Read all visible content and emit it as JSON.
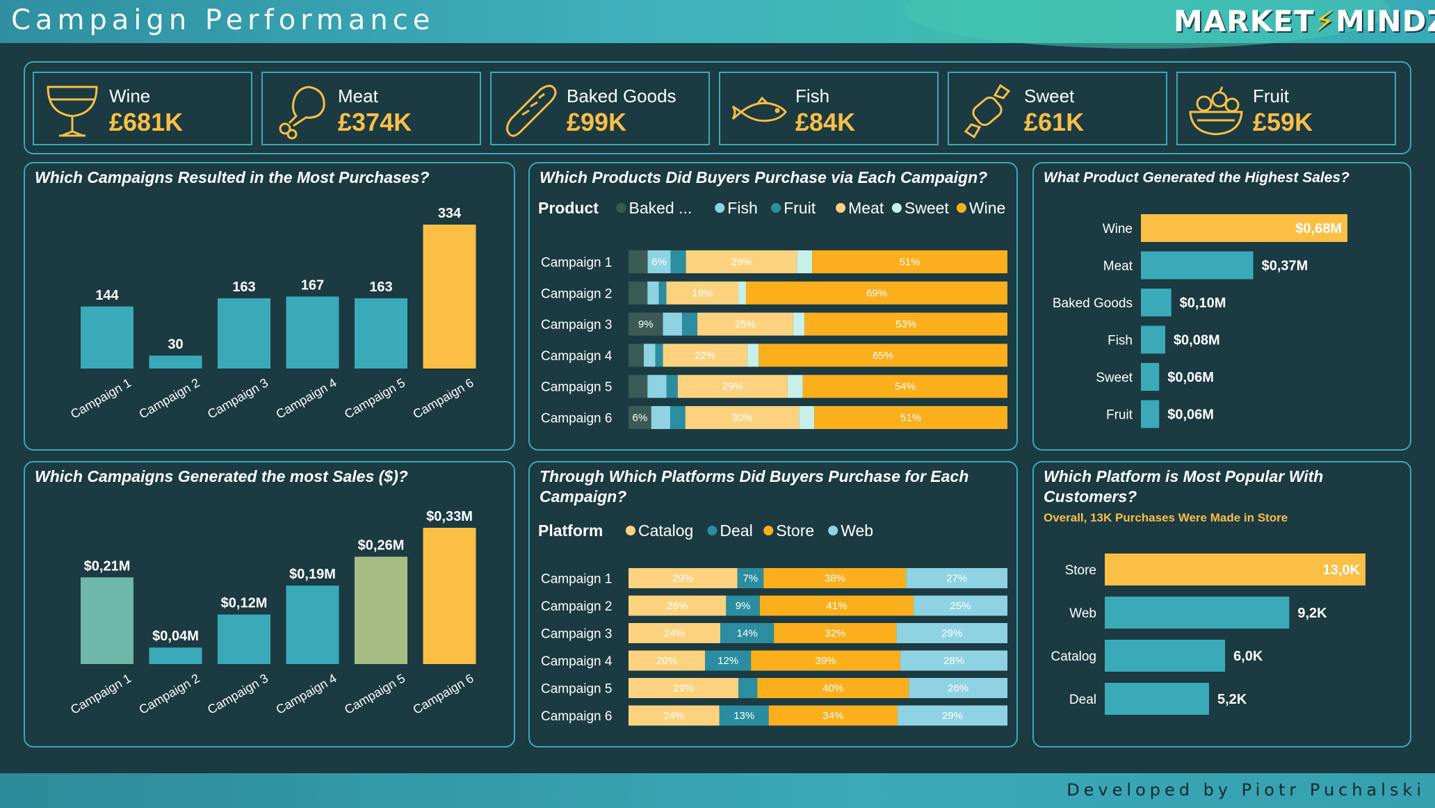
{
  "header": {
    "title": "Campaign Performance",
    "logo_left": "MARKET",
    "logo_right": "MINDZ"
  },
  "footer": {
    "credit": "Developed by Piotr Puchalski"
  },
  "colors": {
    "teal": "#3aaab8",
    "gold": "#fbbf45",
    "orange": "#fbaf1c",
    "light_gold": "#fcd27f",
    "bg": "#1b3a42",
    "dark_gray": "#3b5a55",
    "light_blue": "#8fd3e3",
    "mid_teal": "#2b8d9f",
    "mint": "#c7f0e9",
    "sage": "#6fb7a8",
    "olive": "#a8bd84"
  },
  "kpis": [
    {
      "label": "Wine",
      "value": "£681K",
      "icon": "wine-glass-icon"
    },
    {
      "label": "Meat",
      "value": "£374K",
      "icon": "drumstick-icon"
    },
    {
      "label": "Baked Goods",
      "value": "£99K",
      "icon": "baguette-icon"
    },
    {
      "label": "Fish",
      "value": "£84K",
      "icon": "fish-icon"
    },
    {
      "label": "Sweet",
      "value": "£61K",
      "icon": "candy-icon"
    },
    {
      "label": "Fruit",
      "value": "£59K",
      "icon": "fruit-bowl-icon"
    }
  ],
  "panels": {
    "purchases": {
      "title": "Which Campaigns Resulted in the Most Purchases?"
    },
    "products": {
      "title": "Which Products Did Buyers Purchase via Each Campaign?",
      "legend_title": "Product"
    },
    "top_product": {
      "title": "What Product Generated the Highest Sales?"
    },
    "sales": {
      "title": "Which Campaigns Generated the most Sales ($)?"
    },
    "platforms": {
      "title_line1": "Through Which Platforms Did Buyers Purchase for Each",
      "title_line2": "Campaign?",
      "legend_title": "Platform"
    },
    "popular_platform": {
      "title_line1": "Which Platform is Most Popular With",
      "title_line2": "Customers?",
      "subtitle": "Overall, 13K Purchases Were Made in Store"
    }
  },
  "chart_data": [
    {
      "id": "purchases",
      "type": "bar",
      "categories": [
        "Campaign 1",
        "Campaign 2",
        "Campaign 3",
        "Campaign 4",
        "Campaign 5",
        "Campaign 6"
      ],
      "values": [
        144,
        30,
        163,
        167,
        163,
        334
      ],
      "labels": [
        "144",
        "30",
        "163",
        "167",
        "163",
        "334"
      ],
      "colors": [
        "#3aaab8",
        "#3aaab8",
        "#3aaab8",
        "#3aaab8",
        "#3aaab8",
        "#fbbf45"
      ],
      "ylim": [
        0,
        334
      ]
    },
    {
      "id": "products",
      "type": "bar",
      "stacked": true,
      "orientation": "horizontal",
      "categories": [
        "Campaign 1",
        "Campaign 2",
        "Campaign 3",
        "Campaign 4",
        "Campaign 5",
        "Campaign 6"
      ],
      "series": [
        {
          "name": "Baked ...",
          "color": "#3b5a55",
          "values": [
            5,
            5,
            9,
            4,
            5,
            6
          ],
          "labels": [
            "",
            "",
            "9%",
            "",
            "",
            "6%"
          ]
        },
        {
          "name": "Fish",
          "color": "#8fd3e3",
          "values": [
            6,
            3,
            5,
            3,
            5,
            5
          ],
          "labels": [
            "6%",
            "",
            "",
            "",
            "",
            ""
          ]
        },
        {
          "name": "Fruit",
          "color": "#2b8d9f",
          "values": [
            4,
            2,
            4,
            2,
            3,
            4
          ],
          "labels": [
            "",
            "",
            "",
            "",
            "",
            ""
          ]
        },
        {
          "name": "Meat",
          "color": "#fcd27f",
          "values": [
            29,
            19,
            25,
            22,
            29,
            30
          ],
          "labels": [
            "29%",
            "19%",
            "25%",
            "22%",
            "29%",
            "30%"
          ]
        },
        {
          "name": "Sweet",
          "color": "#c7f0e9",
          "values": [
            4,
            2,
            3,
            3,
            4,
            4
          ],
          "labels": [
            "",
            "",
            "",
            "",
            "",
            ""
          ]
        },
        {
          "name": "Wine",
          "color": "#fbaf1c",
          "values": [
            51,
            69,
            53,
            65,
            54,
            51
          ],
          "labels": [
            "51%",
            "69%",
            "53%",
            "65%",
            "54%",
            "51%"
          ]
        }
      ],
      "xlim": [
        0,
        100
      ]
    },
    {
      "id": "top_product",
      "type": "bar",
      "orientation": "horizontal",
      "categories": [
        "Wine",
        "Meat",
        "Baked Goods",
        "Fish",
        "Sweet",
        "Fruit"
      ],
      "values": [
        0.68,
        0.37,
        0.1,
        0.08,
        0.06,
        0.06
      ],
      "labels": [
        "$0,68M",
        "$0,37M",
        "$0,10M",
        "$0,08M",
        "$0,06M",
        "$0,06M"
      ],
      "colors": [
        "#fbbf45",
        "#3aaab8",
        "#3aaab8",
        "#3aaab8",
        "#3aaab8",
        "#3aaab8"
      ]
    },
    {
      "id": "sales",
      "type": "bar",
      "categories": [
        "Campaign 1",
        "Campaign 2",
        "Campaign 3",
        "Campaign 4",
        "Campaign 5",
        "Campaign 6"
      ],
      "values": [
        0.21,
        0.04,
        0.12,
        0.19,
        0.26,
        0.33
      ],
      "labels": [
        "$0,21M",
        "$0,04M",
        "$0,12M",
        "$0,19M",
        "$0,26M",
        "$0,33M"
      ],
      "colors": [
        "#6fb7a8",
        "#3aaab8",
        "#3aaab8",
        "#3aaab8",
        "#a8bd84",
        "#fbbf45"
      ],
      "ylim": [
        0,
        0.33
      ]
    },
    {
      "id": "platforms",
      "type": "bar",
      "stacked": true,
      "orientation": "horizontal",
      "categories": [
        "Campaign 1",
        "Campaign 2",
        "Campaign 3",
        "Campaign 4",
        "Campaign 5",
        "Campaign 6"
      ],
      "series": [
        {
          "name": "Catalog",
          "color": "#fcd27f",
          "values": [
            29,
            26,
            24,
            20,
            29,
            24
          ],
          "labels": [
            "29%",
            "26%",
            "24%",
            "20%",
            "29%",
            "24%"
          ]
        },
        {
          "name": "Deal",
          "color": "#2b8d9f",
          "values": [
            7,
            9,
            14,
            12,
            5,
            13
          ],
          "labels": [
            "7%",
            "9%",
            "14%",
            "12%",
            "",
            "13%"
          ]
        },
        {
          "name": "Store",
          "color": "#fbaf1c",
          "values": [
            38,
            41,
            32,
            39,
            40,
            34
          ],
          "labels": [
            "38%",
            "41%",
            "32%",
            "39%",
            "40%",
            "34%"
          ]
        },
        {
          "name": "Web",
          "color": "#8fd3e3",
          "values": [
            27,
            25,
            29,
            28,
            26,
            29
          ],
          "labels": [
            "27%",
            "25%",
            "29%",
            "28%",
            "26%",
            "29%"
          ]
        }
      ],
      "xlim": [
        0,
        100
      ]
    },
    {
      "id": "popular_platform",
      "type": "bar",
      "orientation": "horizontal",
      "categories": [
        "Store",
        "Web",
        "Catalog",
        "Deal"
      ],
      "values": [
        13.0,
        9.2,
        6.0,
        5.2
      ],
      "labels": [
        "13,0K",
        "9,2K",
        "6,0K",
        "5,2K"
      ],
      "colors": [
        "#fbbf45",
        "#3aaab8",
        "#3aaab8",
        "#3aaab8"
      ]
    }
  ]
}
